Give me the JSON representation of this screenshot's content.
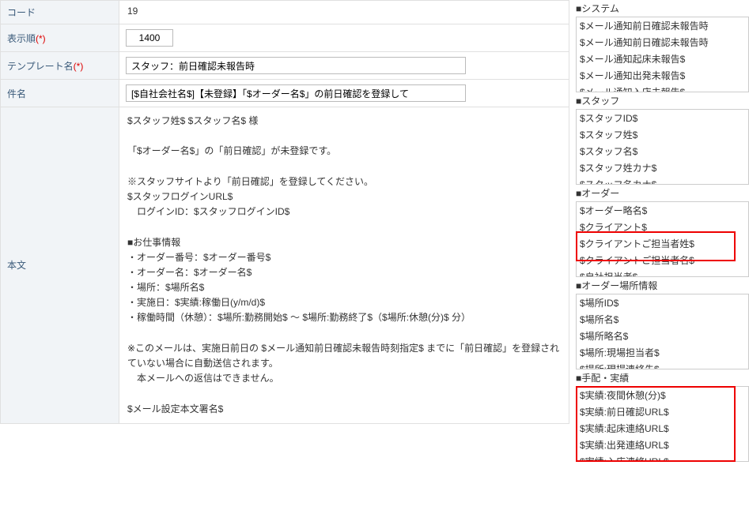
{
  "form": {
    "code_label": "コード",
    "code_value": "19",
    "order_label": "表示順",
    "order_value": "1400",
    "template_label": "テンプレート名",
    "template_value": "スタッフ：前日確認未報告時",
    "subject_label": "件名",
    "subject_value": "[$自社会社名$]【未登録】「$オーダー名$」の前日確認を登録して",
    "body_label": "本文",
    "required_mark": "(*)",
    "body_text": "$スタッフ姓$ $スタッフ名$ 様\n\n「$オーダー名$」の「前日確認」が未登録です。\n\n※スタッフサイトより「前日確認」を登録してください。\n$スタッフログインURL$\n　ログインID：$スタッフログインID$\n\n■お仕事情報\n・オーダー番号：$オーダー番号$\n・オーダー名：$オーダー名$\n・場所：$場所名$\n・実施日：$実績:稼働日(y/m/d)$\n・稼働時間（休憩）：$場所:勤務開始$ ～ $場所:勤務終了$（$場所:休憩(分)$ 分）\n\n※このメールは、実施日前日の $メール通知前日確認未報告時刻指定$ までに「前日確認」を登録されていない場合に自動送信されます。\n　本メールへの返信はできません。\n\n$メール設定本文署名$"
  },
  "sidebar": {
    "sections": [
      {
        "title": "■システム",
        "items": [
          "$メール通知前日確認未報告時",
          "$メール通知前日確認未報告時",
          "$メール通知起床未報告$",
          "$メール通知出発未報告$",
          "$メール通知入店未報告$"
        ]
      },
      {
        "title": "■スタッフ",
        "items": [
          "$スタッフID$",
          "$スタッフ姓$",
          "$スタッフ名$",
          "$スタッフ姓カナ$",
          "$スタッフ名カナ$"
        ]
      },
      {
        "title": "■オーダー",
        "items": [
          "$オーダー略名$",
          "$クライアント$",
          "$クライアントご担当者姓$",
          "$クライアントご担当者名$",
          "$自社担当者$"
        ],
        "highlight_indices": [
          2,
          3
        ]
      },
      {
        "title": "■オーダー場所情報",
        "items": [
          "$場所ID$",
          "$場所名$",
          "$場所略名$",
          "$場所:現場担当者$",
          "$場所:現場連絡先$"
        ]
      },
      {
        "title": "■手配・実績",
        "items": [
          "$実績:夜間休憩(分)$",
          "$実績:前日確認URL$",
          "$実績:起床連絡URL$",
          "$実績:出発連絡URL$",
          "$実績:入店連絡URL$"
        ],
        "highlight_all": true
      }
    ]
  }
}
